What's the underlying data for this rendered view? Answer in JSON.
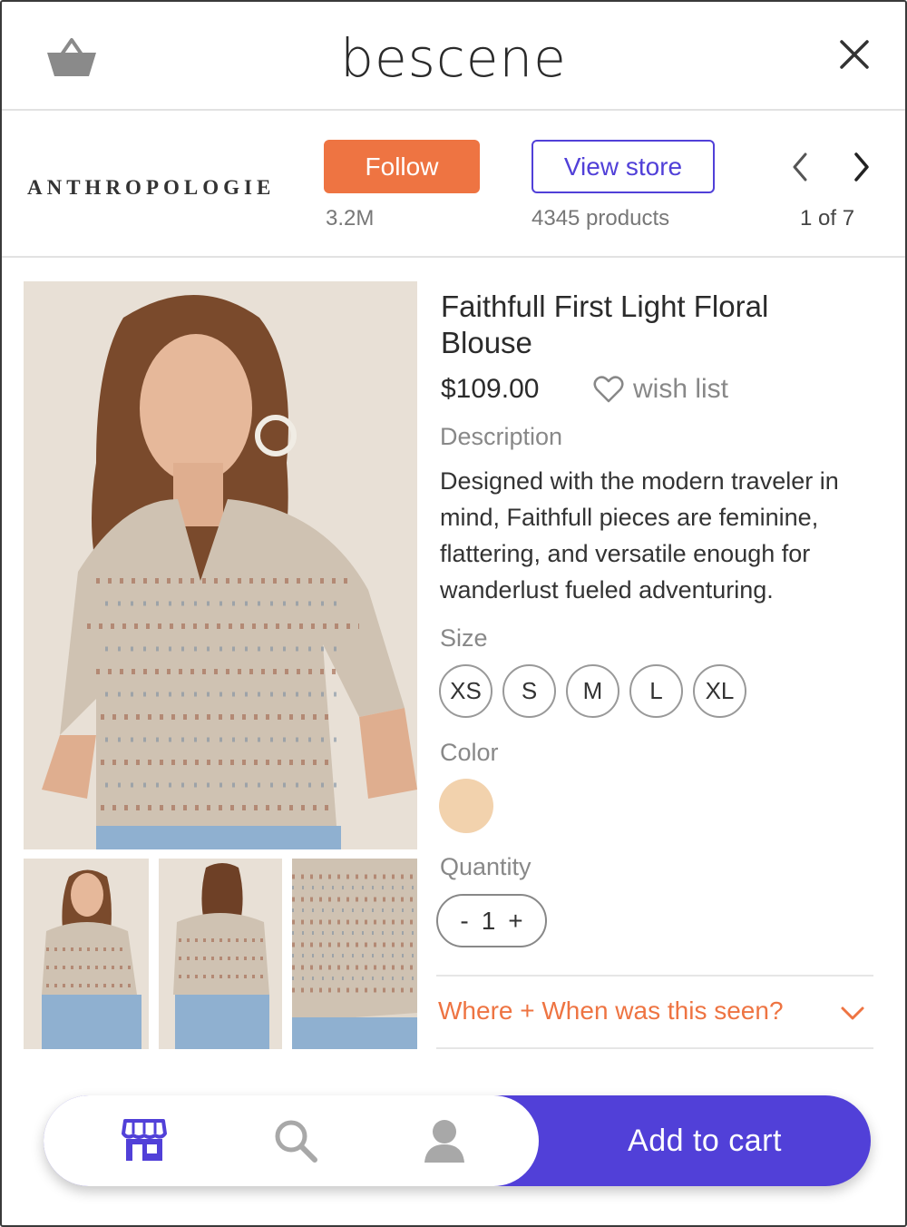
{
  "app": {
    "logo": "bescene"
  },
  "header": {
    "basket_icon": "basket-icon",
    "close_icon": "close-icon"
  },
  "store": {
    "brand": "ANTHROPOLOGIE",
    "follow_label": "Follow",
    "followers": "3.2M",
    "view_store_label": "View store",
    "product_count": "4345 products",
    "pager": "1 of 7"
  },
  "product": {
    "title": "Faithfull First Light Floral Blouse",
    "price": "$109.00",
    "wish_label": "wish list",
    "description_label": "Description",
    "description": "Designed with the modern traveler in mind, Faithfull pieces are feminine, flattering, and versatile enough for wanderlust fueled adventuring.",
    "size_label": "Size",
    "sizes": [
      "XS",
      "S",
      "M",
      "L",
      "XL"
    ],
    "color_label": "Color",
    "color_swatch": "#f2d2ad",
    "quantity_label": "Quantity",
    "quantity_minus": "-",
    "quantity": "1",
    "quantity_plus": "+",
    "where_label": "Where + When was this seen?"
  },
  "nav": {
    "add_to_cart": "Add to cart"
  },
  "colors": {
    "accent": "#5140d8",
    "orange": "#ee7442"
  }
}
